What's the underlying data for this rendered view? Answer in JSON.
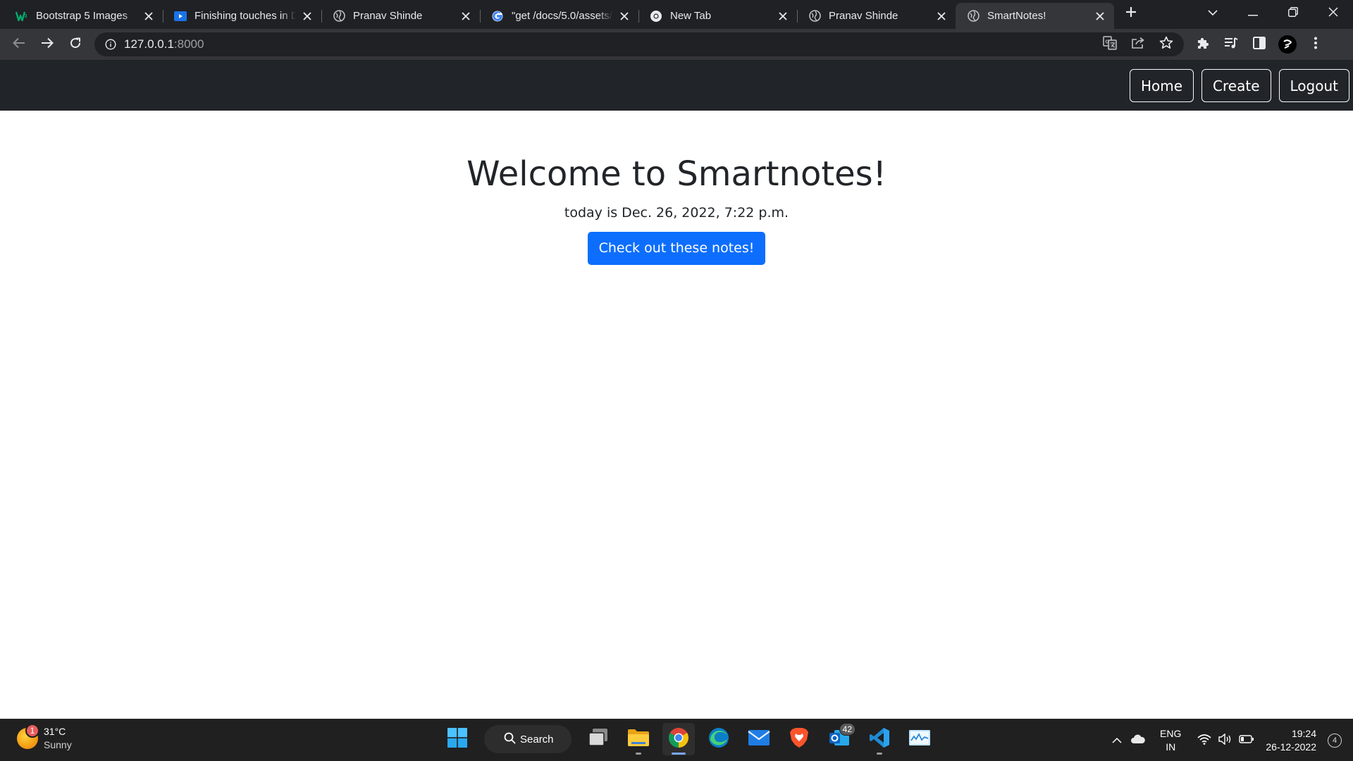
{
  "browser": {
    "tabs": [
      {
        "title": "Bootstrap 5 Images",
        "icon": "w3schools-icon",
        "active": false
      },
      {
        "title": "Finishing touches in Django",
        "icon": "video-icon",
        "active": false
      },
      {
        "title": "Pranav Shinde",
        "icon": "globe-icon",
        "active": false
      },
      {
        "title": "\"get /docs/5.0/assets/",
        "icon": "google-icon",
        "active": false
      },
      {
        "title": "New Tab",
        "icon": "chrome-icon",
        "active": false
      },
      {
        "title": "Pranav Shinde",
        "icon": "globe-icon",
        "active": false
      },
      {
        "title": "SmartNotes!",
        "icon": "globe-icon",
        "active": true
      }
    ],
    "url_host": "127.0.0.1",
    "url_port": ":8000"
  },
  "navbar": {
    "home_label": "Home",
    "create_label": "Create",
    "logout_label": "Logout"
  },
  "main": {
    "heading": "Welcome to Smartnotes!",
    "date_line": "today is Dec. 26, 2022, 7:22 p.m.",
    "cta_label": "Check out these notes!"
  },
  "taskbar": {
    "weather_temp": "31°C",
    "weather_condition": "Sunny",
    "weather_badge": "1",
    "search_label": "Search",
    "mail_badge": "42",
    "lang_top": "ENG",
    "lang_bottom": "IN",
    "time": "19:24",
    "date": "26-12-2022",
    "notification_count": "4"
  },
  "colors": {
    "navbar_bg": "#212529",
    "cta_bg": "#0d6efd",
    "chrome_dark": "#202124",
    "chrome_toolbar": "#35363a"
  }
}
